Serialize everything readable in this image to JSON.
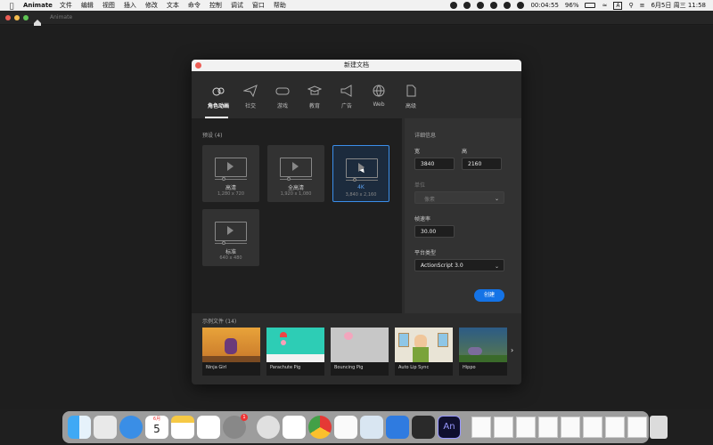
{
  "menubar": {
    "app_name": "Animate",
    "items": [
      "文件",
      "编辑",
      "视图",
      "插入",
      "修改",
      "文本",
      "命令",
      "控制",
      "调试",
      "窗口",
      "帮助"
    ],
    "time_short": "00:04:55",
    "battery": "96%",
    "input_method": "A",
    "date_time": "6月5日 周三  11:58"
  },
  "app": {
    "tab_label": "Animate"
  },
  "dialog": {
    "title": "新建文档",
    "categories": [
      {
        "label": "角色动画",
        "icon": "character-animation-icon"
      },
      {
        "label": "社交",
        "icon": "paper-plane-icon"
      },
      {
        "label": "游戏",
        "icon": "gamepad-icon"
      },
      {
        "label": "教育",
        "icon": "graduation-cap-icon"
      },
      {
        "label": "广告",
        "icon": "megaphone-icon"
      },
      {
        "label": "Web",
        "icon": "globe-icon"
      },
      {
        "label": "高级",
        "icon": "document-icon"
      }
    ],
    "presets_label": "预设 (4)",
    "presets": [
      {
        "name": "高清",
        "size": "1,280 x 720"
      },
      {
        "name": "全高清",
        "size": "1,920 x 1,080"
      },
      {
        "name": "4K",
        "size": "3,840 x 2,160"
      },
      {
        "name": "标准",
        "size": "640 x 480"
      }
    ],
    "details": {
      "heading": "详细信息",
      "width_label": "宽",
      "width_value": "3840",
      "height_label": "高",
      "height_value": "2160",
      "unit_label": "单位",
      "unit_value": "像素",
      "fps_label": "帧速率",
      "fps_value": "30.00",
      "platform_label": "平台类型",
      "platform_value": "ActionScript 3.0",
      "create_label": "创建"
    },
    "samples_label": "示例文件 (14)",
    "samples": [
      "Ninja Girl",
      "Parachute Pig",
      "Bouncing Pig",
      "Auto Lip Sync",
      "Hippo"
    ]
  },
  "dock": {
    "calendar_month": "6月",
    "calendar_day": "5",
    "settings_badge": "1",
    "animate_label": "An"
  },
  "colors": {
    "accent": "#1473e6",
    "selection_border": "#3b8eea"
  }
}
